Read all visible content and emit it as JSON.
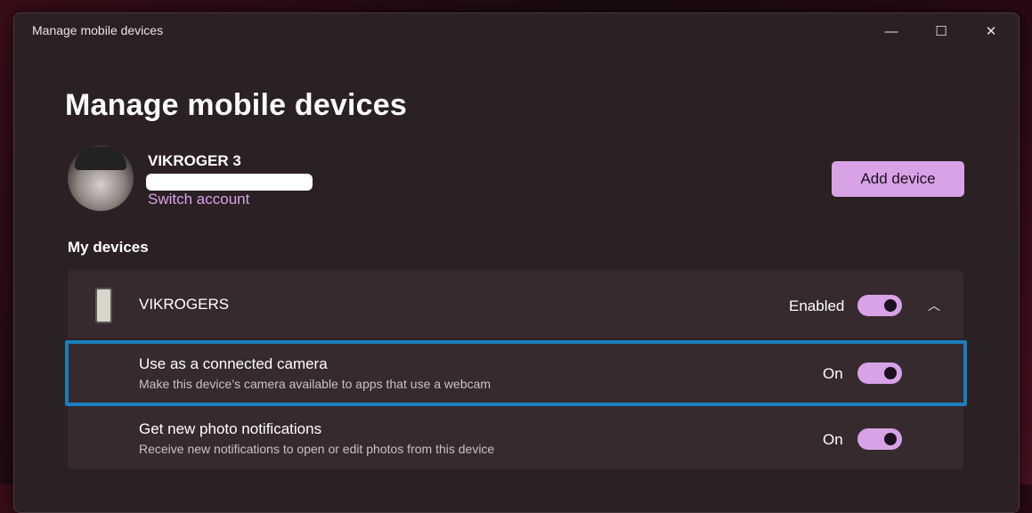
{
  "window": {
    "title": "Manage mobile devices",
    "controls": {
      "minimize": "—",
      "maximize": "☐",
      "close": "✕"
    }
  },
  "page": {
    "heading": "Manage mobile devices"
  },
  "account": {
    "name": "VIKROGER 3",
    "switch_label": "Switch account",
    "add_device_label": "Add device"
  },
  "devices_section": {
    "title": "My devices"
  },
  "device": {
    "name": "VIKROGERS",
    "status_label": "Enabled",
    "enabled": true,
    "chevron": "︿",
    "settings": [
      {
        "title": "Use as a connected camera",
        "description": "Make this device’s camera available to apps that use a webcam",
        "state_label": "On",
        "on": true
      },
      {
        "title": "Get new photo notifications",
        "description": "Receive new notifications to open or edit photos from this device",
        "state_label": "On",
        "on": true
      }
    ]
  },
  "colors": {
    "accent": "#d7a2e6",
    "highlight_border": "#1a7fbd",
    "card": "#362a2f",
    "window": "#2b2024"
  }
}
